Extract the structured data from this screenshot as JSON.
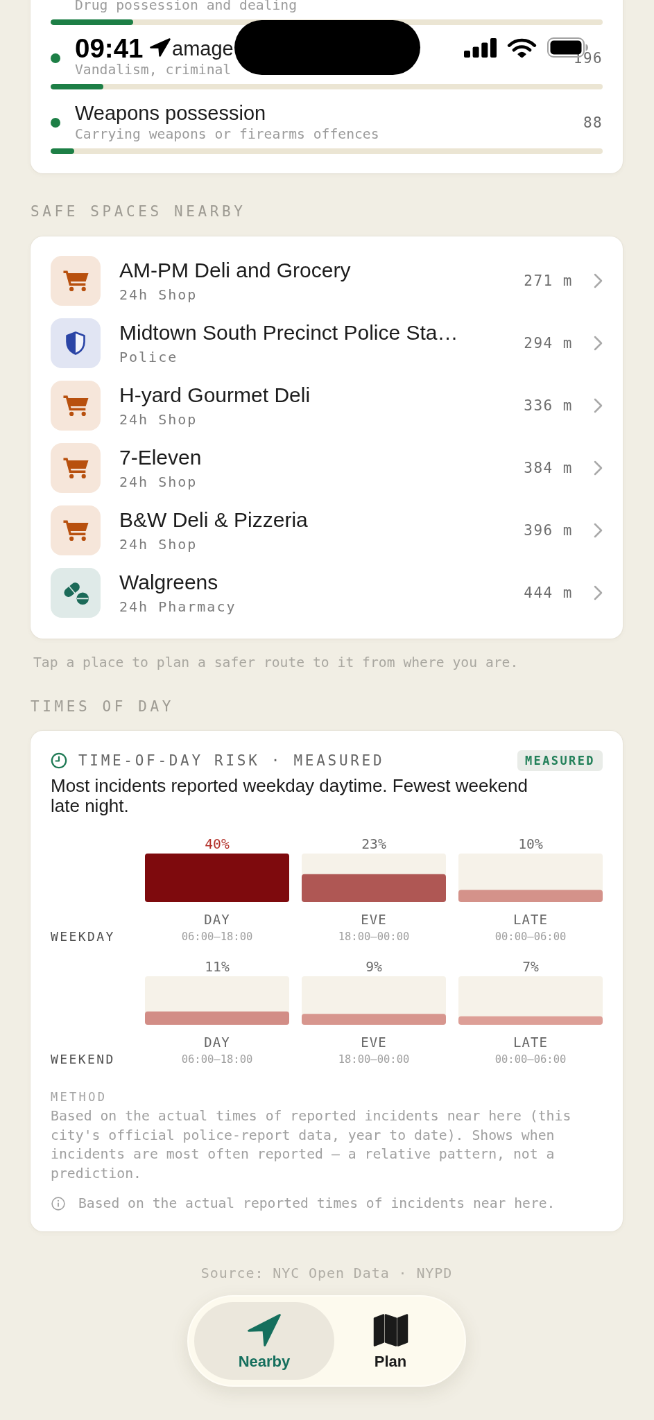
{
  "status_bar": {
    "time": "09:41"
  },
  "offence_types": [
    {
      "kind": "clipped",
      "subtitle": "Drug possession and dealing",
      "level": 0.15
    },
    {
      "kind": "overlaid",
      "title": "amage",
      "subtitle": "Vandalism, criminal",
      "count": "196",
      "level": 0.095
    },
    {
      "kind": "plain",
      "title": "Weapons possession",
      "subtitle": "Carrying weapons or firearms offences",
      "count": "88",
      "level": 0.043
    }
  ],
  "safe_spaces": {
    "heading": "SAFE SPACES NEARBY",
    "places": [
      {
        "kind": "shop",
        "name": "AM-PM Deli and Grocery",
        "category": "24h Shop",
        "distance": "271 m"
      },
      {
        "kind": "police",
        "name": "Midtown South Precinct Police Sta…",
        "category": "Police",
        "distance": "294 m"
      },
      {
        "kind": "shop",
        "name": "H-yard Gourmet Deli",
        "category": "24h Shop",
        "distance": "336 m"
      },
      {
        "kind": "shop",
        "name": "7-Eleven",
        "category": "24h Shop",
        "distance": "384 m"
      },
      {
        "kind": "shop",
        "name": "B&W Deli & Pizzeria",
        "category": "24h Shop",
        "distance": "396 m"
      },
      {
        "kind": "pharmacy",
        "name": "Walgreens",
        "category": "24h Pharmacy",
        "distance": "444 m"
      }
    ],
    "hint": "Tap a place to plan a safer route to it from where you are."
  },
  "times_of_day": {
    "heading": "TIMES OF DAY",
    "title": "TIME-OF-DAY RISK · MEASURED",
    "badge": "MEASURED",
    "summary": "Most incidents reported weekday daytime. Fewest weekend late night.",
    "rows": [
      {
        "label": "WEEKDAY",
        "ranges": [
          "06:00–18:00",
          "18:00–00:00",
          "00:00–06:00"
        ],
        "chart_data": {
          "type": "bar",
          "categories": [
            "DAY",
            "EVE",
            "LATE"
          ],
          "values": [
            40,
            23,
            10
          ],
          "value_labels": [
            "40%",
            "23%",
            "10%"
          ],
          "ylim": [
            0,
            40
          ]
        }
      },
      {
        "label": "WEEKEND",
        "ranges": [
          "06:00–18:00",
          "18:00–00:00",
          "00:00–06:00"
        ],
        "chart_data": {
          "type": "bar",
          "categories": [
            "DAY",
            "EVE",
            "LATE"
          ],
          "values": [
            11,
            9,
            7
          ],
          "value_labels": [
            "11%",
            "9%",
            "7%"
          ],
          "ylim": [
            0,
            40
          ]
        }
      }
    ],
    "method_label": "METHOD",
    "method": "Based on the actual times of reported incidents near here (this city's official police-report data, year to date). Shows when incidents are most often reported — a relative pattern, not a prediction.",
    "note": "Based on the actual reported times of incidents near here."
  },
  "source": "Source: NYC Open Data · NYPD",
  "tab_bar": [
    {
      "kind": "nearby",
      "label": "Nearby",
      "selected": true
    },
    {
      "kind": "map",
      "label": "Plan",
      "selected": false
    }
  ]
}
